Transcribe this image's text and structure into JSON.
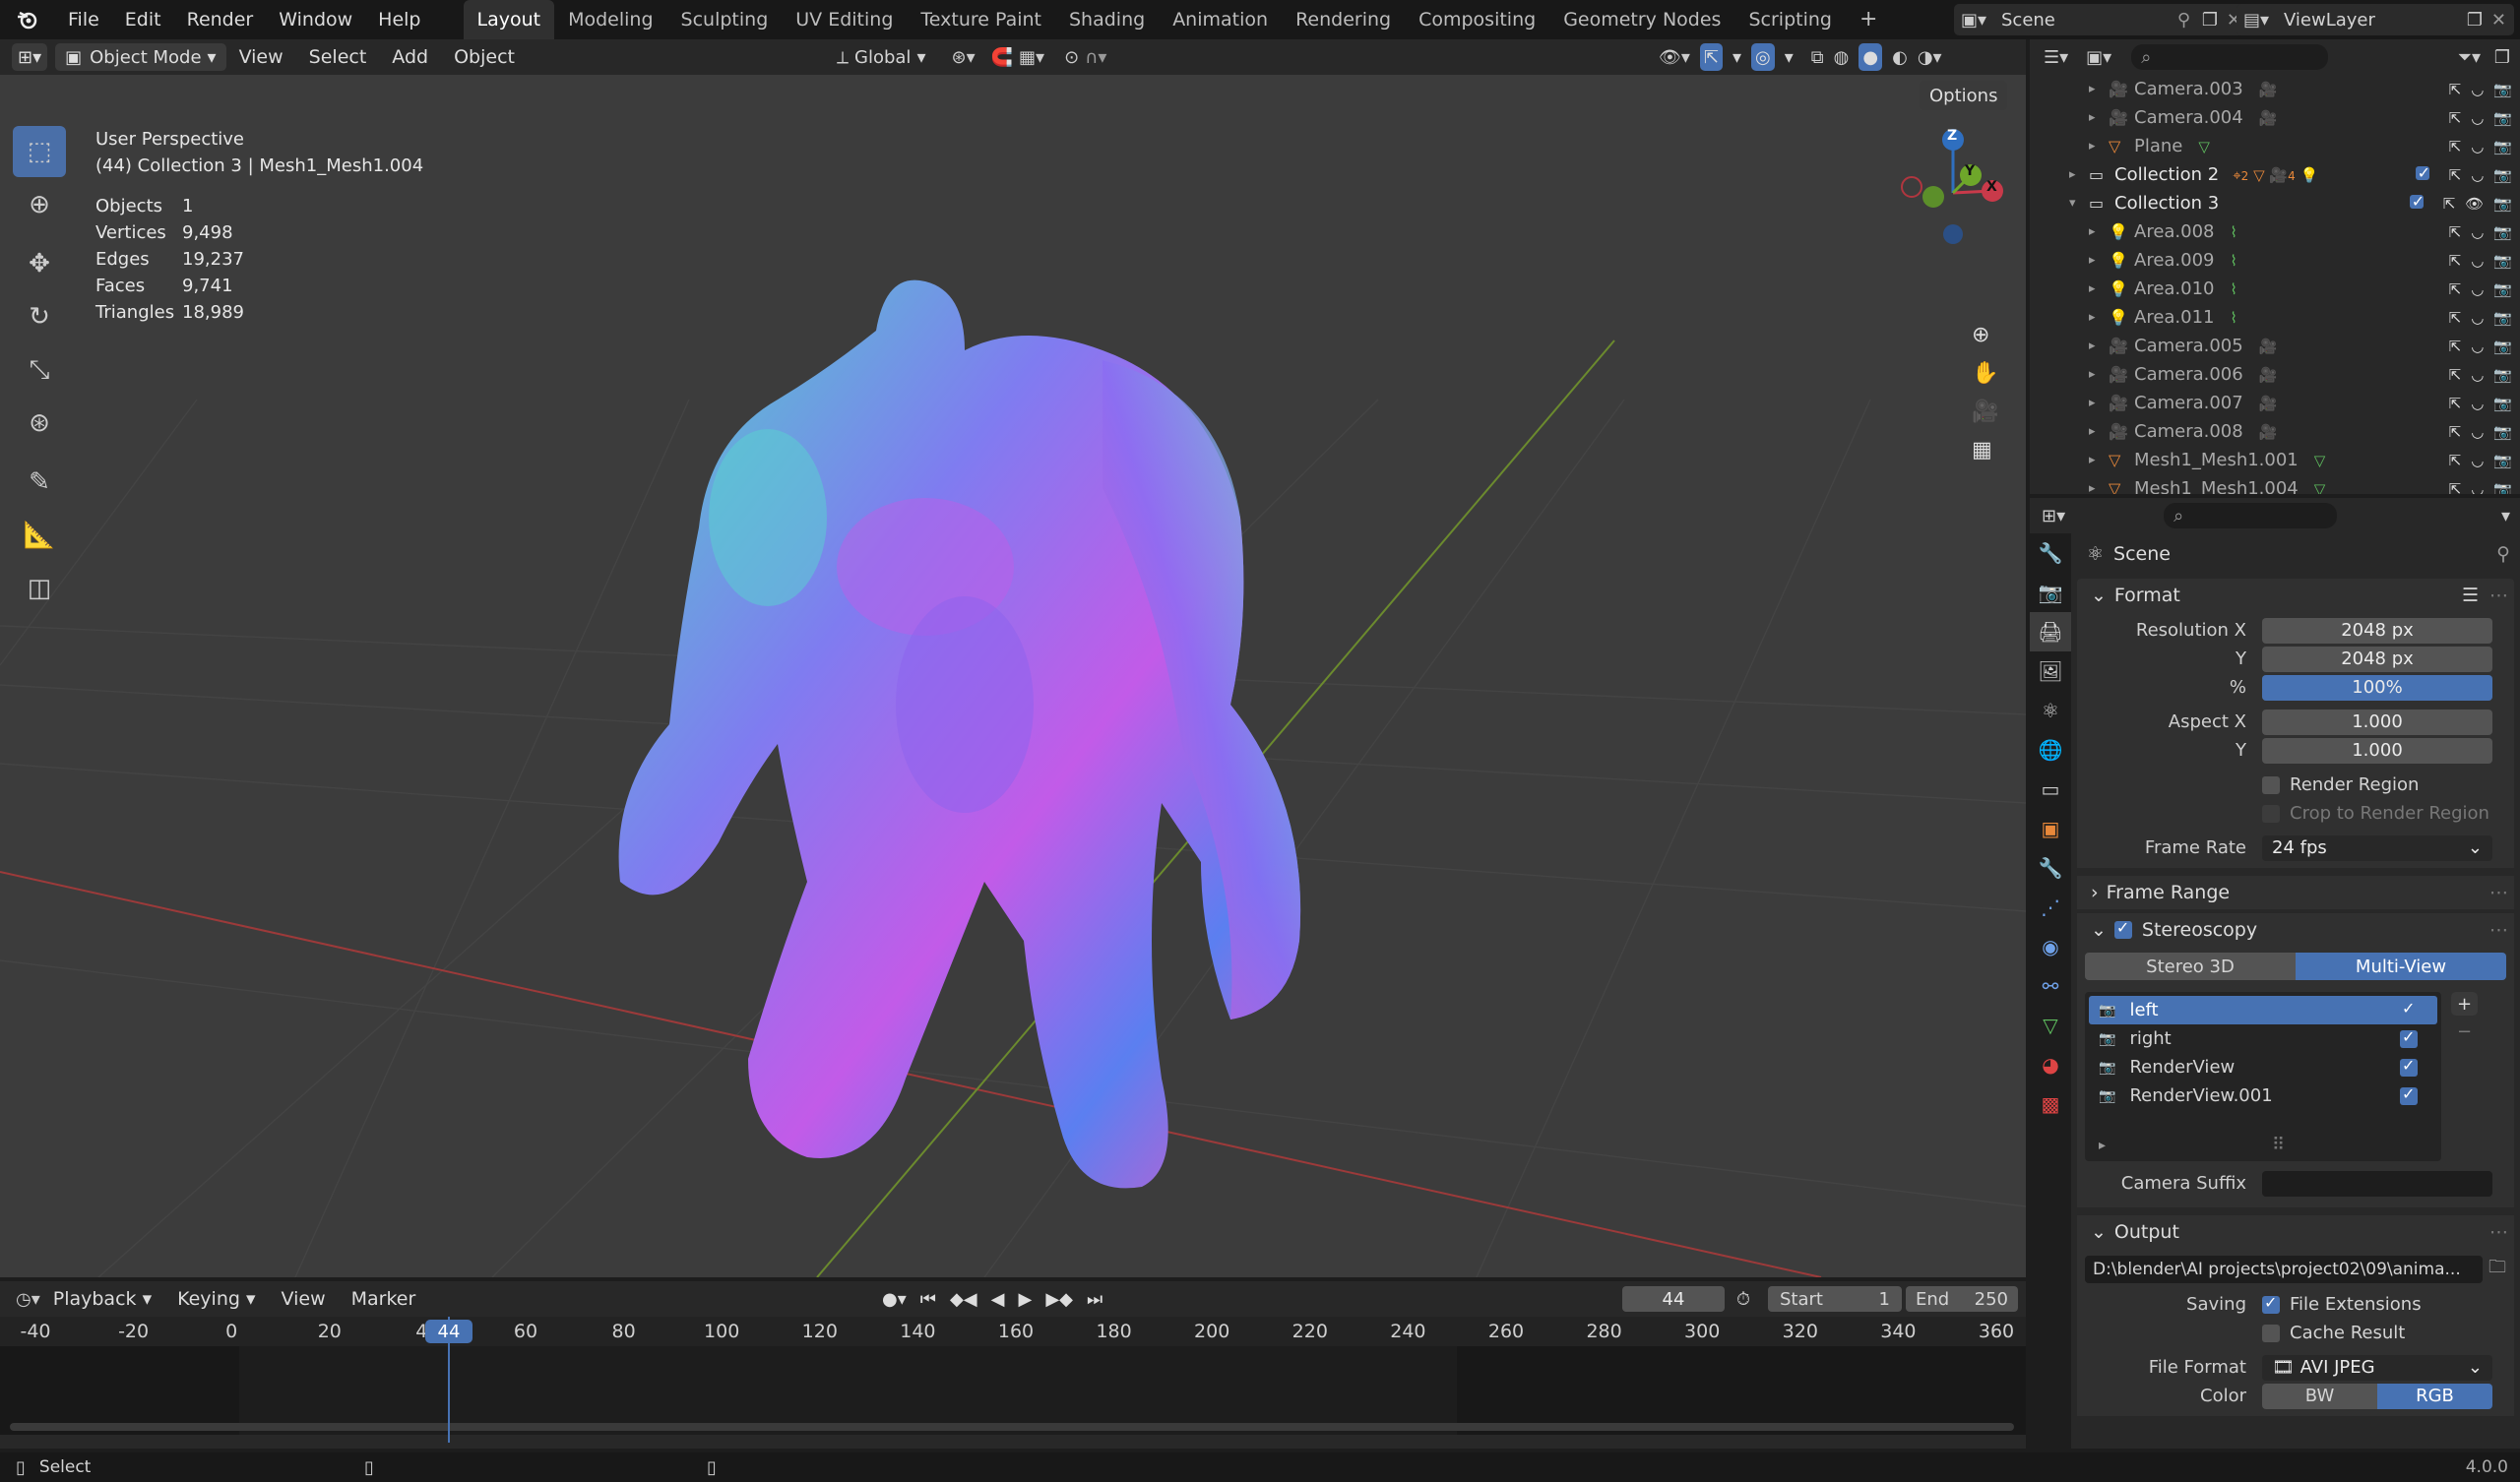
{
  "menu": {
    "file": "File",
    "edit": "Edit",
    "render": "Render",
    "window": "Window",
    "help": "Help"
  },
  "workspaces": [
    "Layout",
    "Modeling",
    "Sculpting",
    "UV Editing",
    "Texture Paint",
    "Shading",
    "Animation",
    "Rendering",
    "Compositing",
    "Geometry Nodes",
    "Scripting"
  ],
  "scene": {
    "name": "Scene",
    "view_layer": "ViewLayer"
  },
  "viewport_header": {
    "mode": "Object Mode",
    "view": "View",
    "select": "Select",
    "add": "Add",
    "object": "Object",
    "orientation": "Global",
    "options": "Options"
  },
  "overlay_info": {
    "perspective": "User Perspective",
    "collection": "(44) Collection 3 | Mesh1_Mesh1.004",
    "stats": [
      {
        "label": "Objects",
        "value": "1"
      },
      {
        "label": "Vertices",
        "value": "9,498"
      },
      {
        "label": "Edges",
        "value": "19,237"
      },
      {
        "label": "Faces",
        "value": "9,741"
      },
      {
        "label": "Triangles",
        "value": "18,989"
      }
    ]
  },
  "gizmo": {
    "z": "Z",
    "y": "Y",
    "x": "X"
  },
  "outliner": [
    {
      "name": "Camera.003",
      "indent": 2,
      "type": "camera"
    },
    {
      "name": "Camera.004",
      "indent": 2,
      "type": "camera"
    },
    {
      "name": "Plane",
      "indent": 2,
      "type": "mesh"
    },
    {
      "name": "Collection 2",
      "indent": 1,
      "type": "collection",
      "badge": "2",
      "badge2": "4"
    },
    {
      "name": "Collection 3",
      "indent": 1,
      "type": "collection",
      "open": true
    },
    {
      "name": "Area.008",
      "indent": 2,
      "type": "light"
    },
    {
      "name": "Area.009",
      "indent": 2,
      "type": "light"
    },
    {
      "name": "Area.010",
      "indent": 2,
      "type": "light"
    },
    {
      "name": "Area.011",
      "indent": 2,
      "type": "light"
    },
    {
      "name": "Camera.005",
      "indent": 2,
      "type": "camera"
    },
    {
      "name": "Camera.006",
      "indent": 2,
      "type": "camera"
    },
    {
      "name": "Camera.007",
      "indent": 2,
      "type": "camera"
    },
    {
      "name": "Camera.008",
      "indent": 2,
      "type": "camera"
    },
    {
      "name": "Mesh1_Mesh1.001",
      "indent": 2,
      "type": "mesh"
    },
    {
      "name": "Mesh1_Mesh1.004",
      "indent": 2,
      "type": "mesh"
    }
  ],
  "properties": {
    "breadcrumb": "Scene",
    "format": {
      "title": "Format",
      "res_x_label": "Resolution X",
      "res_x": "2048 px",
      "res_y_label": "Y",
      "res_y": "2048 px",
      "pct_label": "%",
      "pct": "100%",
      "pct_value": 100,
      "aspect_x_label": "Aspect X",
      "aspect_x": "1.000",
      "aspect_y_label": "Y",
      "aspect_y": "1.000",
      "render_region": "Render Region",
      "crop": "Crop to Render Region",
      "frame_rate_label": "Frame Rate",
      "frame_rate": "24 fps"
    },
    "frame_range": "Frame Range",
    "stereo": {
      "title": "Stereoscopy",
      "stereo3d": "Stereo 3D",
      "multiview": "Multi-View",
      "views": [
        "left",
        "right",
        "RenderView",
        "RenderView.001"
      ],
      "camera_suffix": "Camera Suffix"
    },
    "output": {
      "title": "Output",
      "path": "D:\\blender\\AI projects\\project02\\09\\anima...",
      "saving": "Saving",
      "file_ext": "File Extensions",
      "cache": "Cache Result",
      "file_format_label": "File Format",
      "file_format": "AVI JPEG",
      "color_label": "Color",
      "bw": "BW",
      "rgb": "RGB"
    }
  },
  "timeline": {
    "playback": "Playback",
    "keying": "Keying",
    "view": "View",
    "marker": "Marker",
    "current": "44",
    "start_label": "Start",
    "start": "1",
    "end_label": "End",
    "end": "250",
    "ticks": [
      "-40",
      "-20",
      "0",
      "20",
      "40",
      "60",
      "80",
      "100",
      "120",
      "140",
      "160",
      "180",
      "200",
      "220",
      "240",
      "260",
      "280",
      "300",
      "320",
      "340",
      "360"
    ]
  },
  "status": {
    "select": "Select",
    "version": "4.0.0"
  }
}
